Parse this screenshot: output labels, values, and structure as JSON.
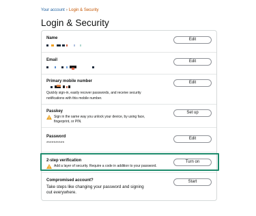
{
  "breadcrumb": {
    "parent": "Your account",
    "separator": "›",
    "current": "Login & Security"
  },
  "page": {
    "title": "Login & Security"
  },
  "rows": {
    "name": {
      "title": "Name",
      "button": "Edit"
    },
    "email": {
      "title": "Email",
      "button": "Edit"
    },
    "mobile": {
      "title": "Primary mobile number",
      "description": "Quickly sign-in, easily recover passwords, and receive security notifications with this mobile number.",
      "button": "Edit"
    },
    "passkey": {
      "title": "Passkey",
      "warning": "Sign in the same way you unlock your device, by using face, fingerprint, or PIN.",
      "button": "Set up"
    },
    "password": {
      "title": "Password",
      "value": "**********",
      "button": "Edit"
    },
    "two_step": {
      "title": "2-step verification",
      "warning": "Add a layer of security. Require a code in addition to your password.",
      "button": "Turn on"
    },
    "compromised": {
      "title": "Compromised account?",
      "description": "Take steps like changing your password and signing out everywhere.",
      "button": "Start"
    }
  },
  "icons": {
    "warning": "warning-triangle-icon"
  },
  "colors": {
    "link": "#2162a1",
    "current_breadcrumb": "#c45500",
    "highlight": "#1b8a6b",
    "warning": "#f0a41b"
  }
}
